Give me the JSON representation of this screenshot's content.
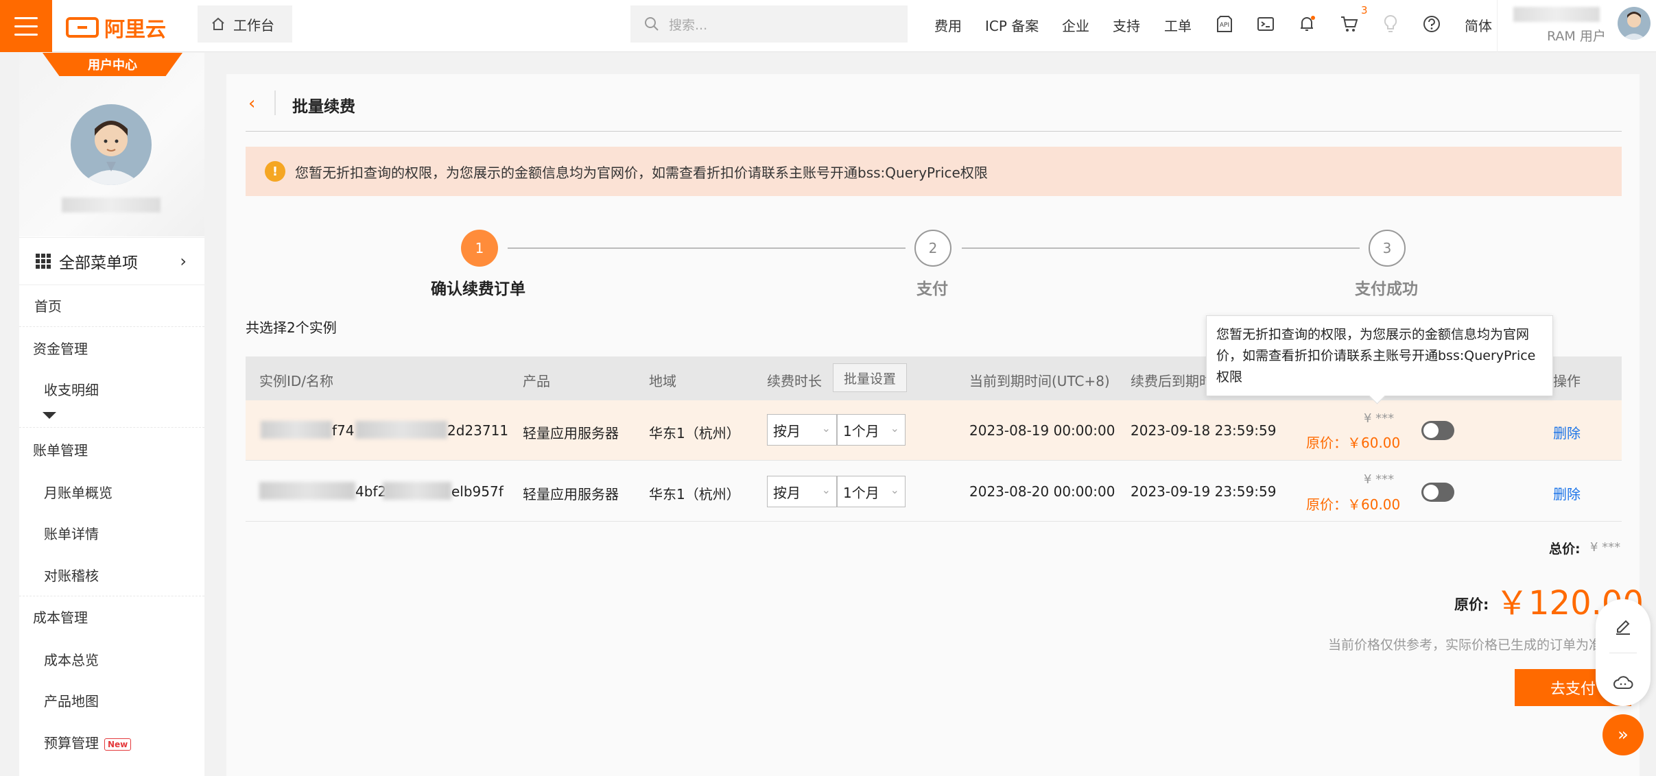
{
  "topbar": {
    "logo_text": "阿里云",
    "workbench_label": "工作台",
    "search_placeholder": "搜索...",
    "nav": [
      "费用",
      "ICP 备案",
      "企业",
      "支持",
      "工单"
    ],
    "cart_count": "3",
    "language": "简体",
    "account_type": "RAM 用户"
  },
  "sidebar": {
    "badge": "用户中心",
    "all_menu": "全部菜单项",
    "home": "首页",
    "groups": [
      {
        "title": "资金管理",
        "items": [
          "收支明细"
        ]
      },
      {
        "title": "账单管理",
        "items": [
          "月账单概览",
          "账单详情",
          "对账稽核"
        ]
      },
      {
        "title": "成本管理",
        "items": [
          "成本总览",
          "产品地图",
          "预算管理"
        ]
      }
    ],
    "new_badge": "New"
  },
  "page": {
    "title": "批量续费",
    "notice": "您暂无折扣查询的权限，为您展示的金额信息均为官网价，如需查看折扣价请联系主账号开通bss:QueryPrice权限",
    "steps": [
      {
        "num": "1",
        "label": "确认续费订单"
      },
      {
        "num": "2",
        "label": "支付"
      },
      {
        "num": "3",
        "label": "支付成功"
      }
    ],
    "selected_count": "共选择2个实例"
  },
  "table": {
    "headers": {
      "instance": "实例ID/名称",
      "product": "产品",
      "region": "地域",
      "duration": "续费时长",
      "batch_btn": "批量设置",
      "current_expiry": "当前到期时间(UTC+8)",
      "new_expiry": "续费后到期时",
      "action": "操作"
    },
    "rows": [
      {
        "id_part1": "f74",
        "id_part2": "2d23711",
        "product": "轻量应用服务器",
        "region": "华东1（杭州）",
        "unit": "按月",
        "duration": "1个月",
        "current_expiry": "2023-08-19 00:00:00",
        "new_expiry": "2023-09-18 23:59:59",
        "price_masked": "¥ ***",
        "orig_price": "原价：￥60.00",
        "delete": "删除"
      },
      {
        "id_part1": "4bf2",
        "id_part2": "elb957f",
        "product": "轻量应用服务器",
        "region": "华东1（杭州）",
        "unit": "按月",
        "duration": "1个月",
        "current_expiry": "2023-08-20 00:00:00",
        "new_expiry": "2023-09-19 23:59:59",
        "price_masked": "¥ ***",
        "orig_price": "原价：￥60.00",
        "delete": "删除"
      }
    ]
  },
  "tooltip": {
    "text": "您暂无折扣查询的权限，为您展示的金额信息均为官网价，如需查看折扣价请联系主账号开通bss:QueryPrice权限"
  },
  "summary": {
    "total_label": "总价:",
    "total_masked": "¥ ***",
    "orig_label": "原价:",
    "orig_value": "￥120.00",
    "disclaimer": "当前价格仅供参考，实际价格已生成的订单为准",
    "pay_button": "去支付"
  },
  "colors": {
    "accent": "#ff6a00",
    "notice_bg": "#fbe2d5",
    "link": "#1a73e8"
  }
}
